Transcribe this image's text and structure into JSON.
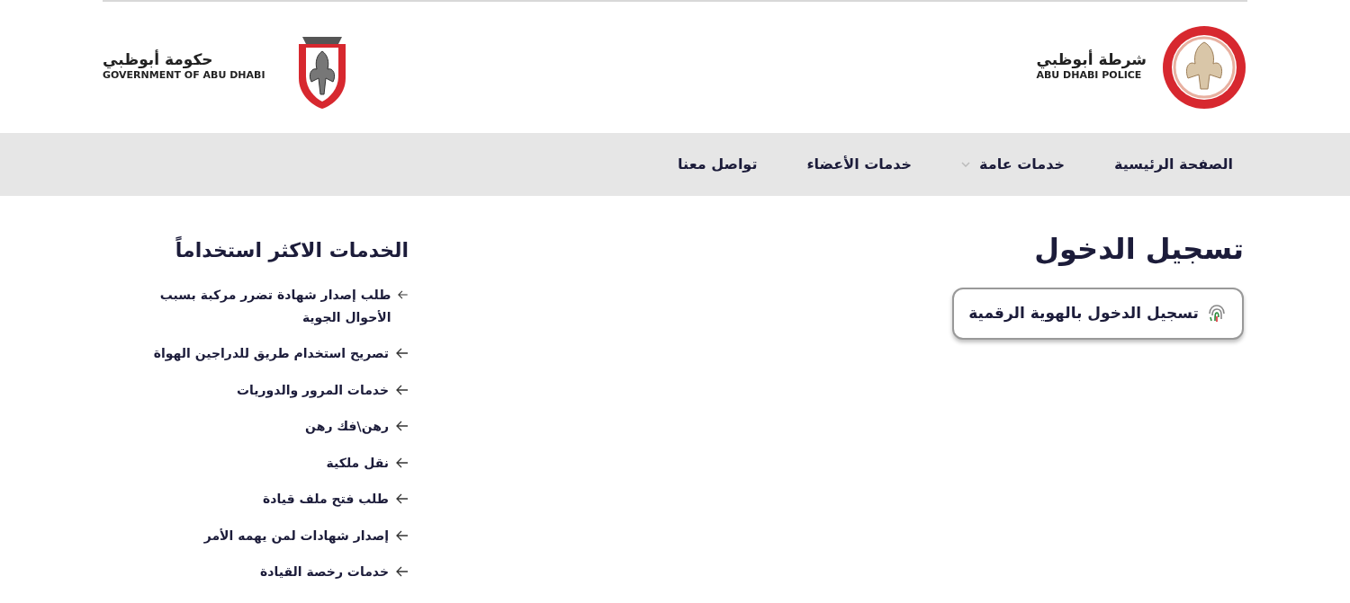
{
  "header": {
    "police_logo": {
      "arabic": "شرطة أبوظبي",
      "english": "ABU DHABI POLICE"
    },
    "government_logo": {
      "arabic": "حكومة أبوظبي",
      "english": "GOVERNMENT OF ABU DHABI"
    }
  },
  "nav": [
    {
      "label": "الصفحة الرئيسية",
      "has_dropdown": false
    },
    {
      "label": "خدمات عامة",
      "has_dropdown": true
    },
    {
      "label": "خدمات الأعضاء",
      "has_dropdown": false
    },
    {
      "label": "تواصل معنا",
      "has_dropdown": false
    }
  ],
  "login": {
    "title": "تسجيل الدخول",
    "button": "تسجيل الدخول بالهوية الرقمية"
  },
  "popular_services": {
    "title": "الخدمات الاكثر استخداماً",
    "items": [
      "طلب إصدار شهادة تضرر مركبة بسبب الأحوال الجوية",
      "تصريح استخدام طريق للدراجين الهواة",
      "خدمات المرور والدوريات",
      "رهن\\فك رهن",
      "نقل ملكية",
      "طلب فتح ملف قيادة",
      "إصدار شهادات لمن يهمه الأمر",
      "خدمات رخصة القيادة"
    ]
  }
}
